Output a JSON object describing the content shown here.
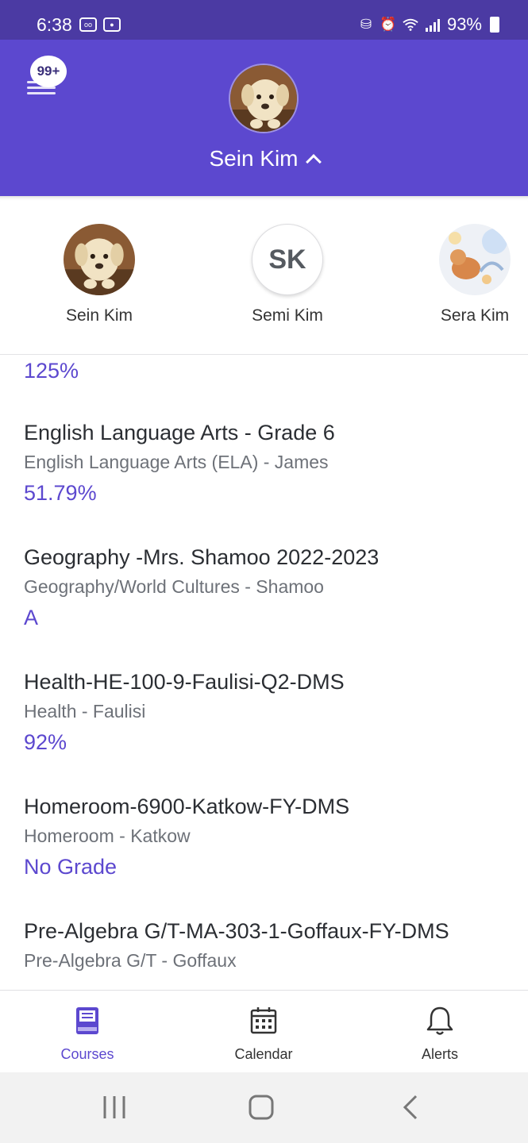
{
  "status_bar": {
    "time": "6:38",
    "battery": "93%"
  },
  "header": {
    "badge": "99+",
    "student_name": "Sein Kim"
  },
  "profiles": [
    {
      "name": "Sein Kim",
      "initials": ""
    },
    {
      "name": "Semi Kim",
      "initials": "SK"
    },
    {
      "name": "Sera Kim",
      "initials": ""
    }
  ],
  "courses": {
    "partial_grade": "125%",
    "items": [
      {
        "title": "English Language Arts - Grade 6",
        "subtitle": "English Language Arts (ELA) - James",
        "grade": "51.79%"
      },
      {
        "title": "Geography -Mrs. Shamoo 2022-2023",
        "subtitle": "Geography/World Cultures - Shamoo",
        "grade": "A"
      },
      {
        "title": "Health-HE-100-9-Faulisi-Q2-DMS",
        "subtitle": "Health - Faulisi",
        "grade": "92%"
      },
      {
        "title": "Homeroom-6900-Katkow-FY-DMS",
        "subtitle": "Homeroom - Katkow",
        "grade": "No Grade"
      },
      {
        "title": "Pre-Algebra G/T-MA-303-1-Goffaux-FY-DMS",
        "subtitle": "Pre-Algebra G/T - Goffaux",
        "grade": ""
      }
    ]
  },
  "bottom_nav": [
    {
      "label": "Courses",
      "icon": "book-icon",
      "active": true
    },
    {
      "label": "Calendar",
      "icon": "calendar-icon",
      "active": false
    },
    {
      "label": "Alerts",
      "icon": "bell-icon",
      "active": false
    }
  ],
  "colors": {
    "accent": "#5c48cf",
    "status_bar": "#4b3aa3"
  }
}
